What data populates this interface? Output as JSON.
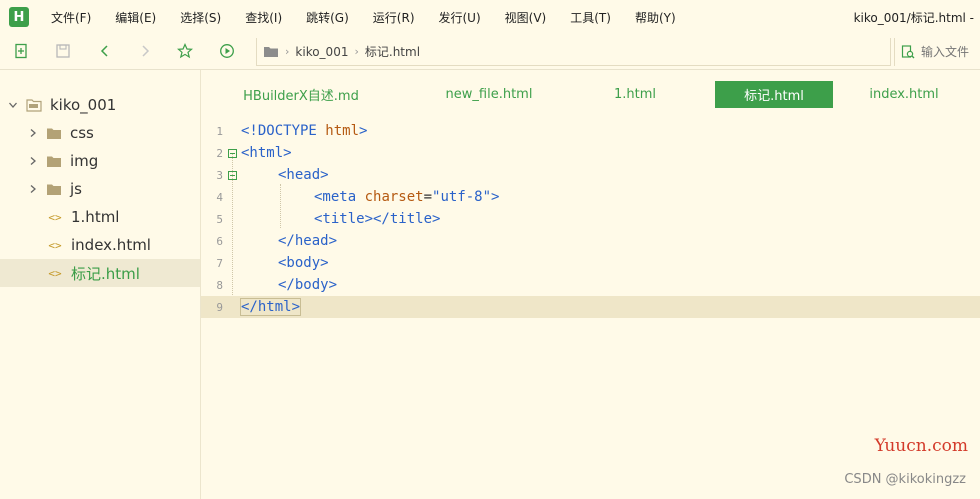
{
  "app": {
    "logo_letter": "H",
    "menus": [
      "文件(F)",
      "编辑(E)",
      "选择(S)",
      "查找(I)",
      "跳转(G)",
      "运行(R)",
      "发行(U)",
      "视图(V)",
      "工具(T)",
      "帮助(Y)"
    ],
    "window_title": "kiko_001/标记.html -"
  },
  "toolbar": {
    "breadcrumb": [
      "kiko_001",
      "标记.html"
    ],
    "search_placeholder": "输入文件"
  },
  "sidebar": {
    "project": "kiko_001",
    "items": [
      {
        "label": "css",
        "type": "folder"
      },
      {
        "label": "img",
        "type": "folder"
      },
      {
        "label": "js",
        "type": "folder"
      },
      {
        "label": "1.html",
        "type": "file"
      },
      {
        "label": "index.html",
        "type": "file"
      },
      {
        "label": "标记.html",
        "type": "file",
        "active": true
      }
    ],
    "file_glyph": "<>"
  },
  "tabs": [
    {
      "label": "HBuilderX自述.md"
    },
    {
      "label": "new_file.html"
    },
    {
      "label": "1.html"
    },
    {
      "label": "标记.html",
      "active": true
    },
    {
      "label": "index.html"
    }
  ],
  "editor": {
    "line_numbers": [
      "1",
      "2",
      "3",
      "4",
      "5",
      "6",
      "7",
      "8",
      "9"
    ],
    "current_line": 9,
    "lines": {
      "l1_open": "<!",
      "l1_doctype": "DOCTYPE",
      "l1_html": " html",
      "l1_close": ">",
      "l2": "<html>",
      "l3": "<head>",
      "l4_open": "<meta",
      "l4_attr": " charset",
      "l4_eq": "=",
      "l4_val": "\"utf-8\"",
      "l4_close": ">",
      "l5": "<title></title>",
      "l6": "</head>",
      "l7": "<body>",
      "l8": "</body>",
      "l9": "</html>"
    }
  },
  "watermarks": {
    "site": "Yuucn.com",
    "author": "CSDN @kikokingzz"
  },
  "colors": {
    "accent": "#3d9f4a",
    "background": "#fffae8",
    "tag": "#2a62c9",
    "attribute": "#b55a12"
  }
}
